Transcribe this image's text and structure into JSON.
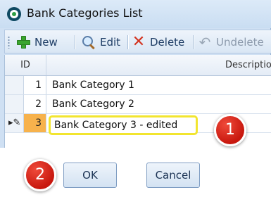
{
  "window": {
    "title": "Bank Categories List",
    "app_icon": "app-logo-icon"
  },
  "toolbar": {
    "new_label": "New",
    "edit_label": "Edit",
    "delete_label": "Delete",
    "undelete_label": "Undelete",
    "icons": {
      "new": "plus-icon",
      "edit": "magnifier-icon",
      "delete": "red-x-icon",
      "undelete": "undo-arrow-icon"
    }
  },
  "grid": {
    "columns": {
      "id": "ID",
      "description": "Description"
    },
    "rows": [
      {
        "id": "1",
        "description": "Bank Category 1"
      },
      {
        "id": "2",
        "description": "Bank Category 2"
      },
      {
        "id": "3",
        "description": "Bank Category 3 - edited"
      }
    ],
    "active_row_indicator": "edit-pencil-icon"
  },
  "callouts": {
    "first": "1",
    "second": "2"
  },
  "buttons": {
    "ok_label": "OK",
    "cancel_label": "Cancel"
  },
  "colors": {
    "active_id_cell": "#f7b24c",
    "edit_highlight": "#f2e52f",
    "callout": "#c8170e",
    "window_bg": "#cfe0f3"
  }
}
